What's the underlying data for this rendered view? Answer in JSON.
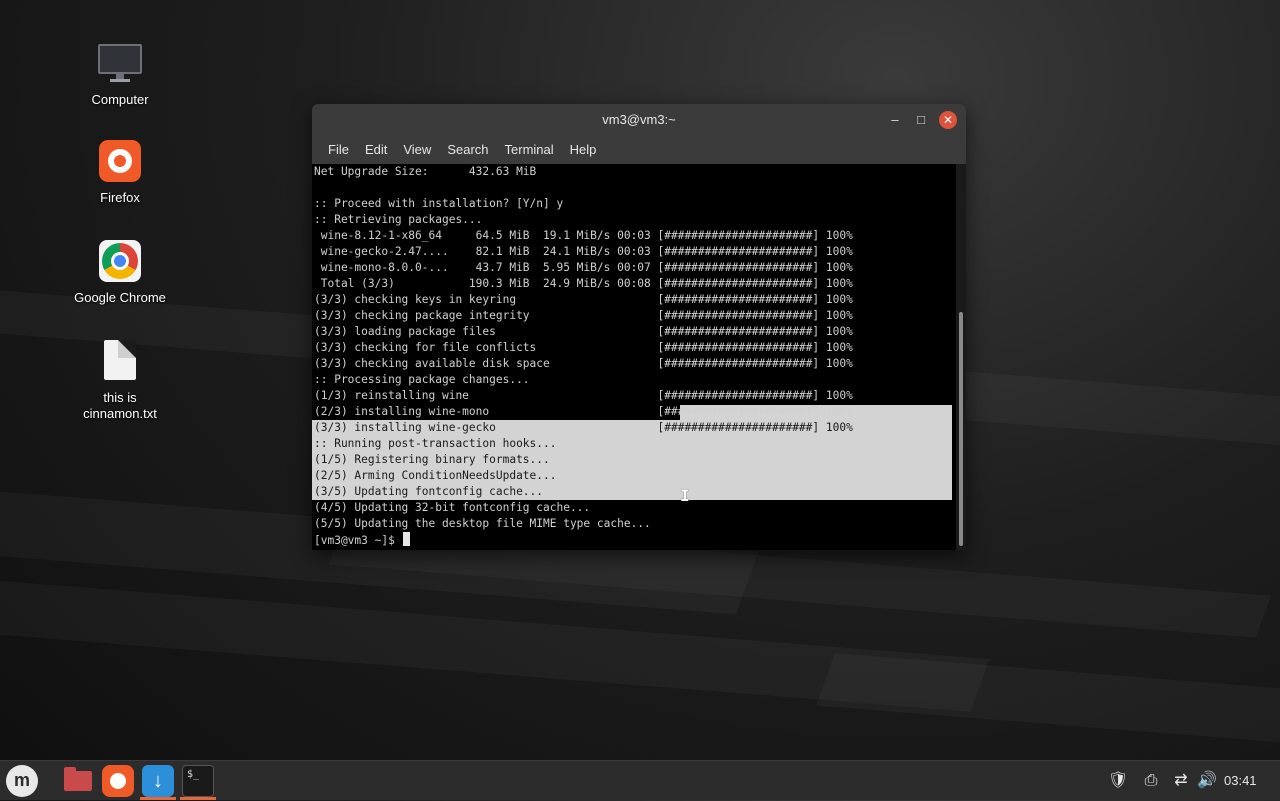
{
  "desktop": {
    "icons": [
      {
        "label": "Computer"
      },
      {
        "label": "Firefox"
      },
      {
        "label": "Google Chrome"
      },
      {
        "label": "this is cinnamon.txt"
      }
    ]
  },
  "window": {
    "title": "vm3@vm3:~",
    "menu": [
      "File",
      "Edit",
      "View",
      "Search",
      "Terminal",
      "Help"
    ]
  },
  "terminal": {
    "lines": [
      "Net Upgrade Size:      432.63 MiB",
      "",
      ":: Proceed with installation? [Y/n] y",
      ":: Retrieving packages...",
      " wine-8.12-1-x86_64     64.5 MiB  19.1 MiB/s 00:03 [######################] 100%",
      " wine-gecko-2.47....    82.1 MiB  24.1 MiB/s 00:03 [######################] 100%",
      " wine-mono-8.0.0-...    43.7 MiB  5.95 MiB/s 00:07 [######################] 100%",
      " Total (3/3)           190.3 MiB  24.9 MiB/s 00:08 [######################] 100%",
      "(3/3) checking keys in keyring                     [######################] 100%",
      "(3/3) checking package integrity                   [######################] 100%",
      "(3/3) loading package files                        [######################] 100%",
      "(3/3) checking for file conflicts                  [######################] 100%",
      "(3/3) checking available disk space                [######################] 100%",
      ":: Processing package changes...",
      "(1/3) reinstalling wine                            [######################] 100%",
      "(2/3) installing wine-mono                         [######################] 100%",
      "(3/3) installing wine-gecko                        [######################] 100%",
      ":: Running post-transaction hooks...",
      "(1/5) Registering binary formats...",
      "(2/5) Arming ConditionNeedsUpdate...",
      "(3/5) Updating fontconfig cache...",
      "(4/5) Updating 32-bit fontconfig cache...",
      "(5/5) Updating the desktop file MIME type cache...",
      "[vm3@vm3 ~]$"
    ]
  },
  "taskbar": {
    "clock": "03:41",
    "terminal_icon_text": "$_"
  }
}
